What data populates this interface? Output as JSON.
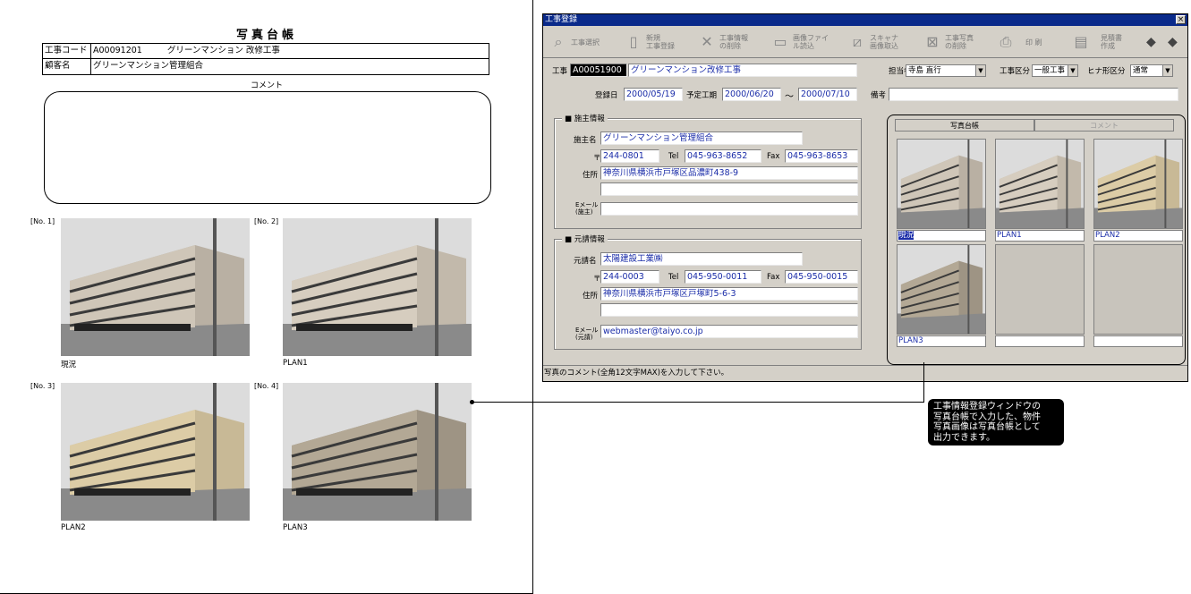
{
  "report": {
    "title": "写真台帳",
    "project_label": "工事コード",
    "project_code": "A00091201",
    "project_name": "グリーンマンション 改修工事",
    "customer_label": "顧客名",
    "customer_name": "グリーンマンション管理組合",
    "comment_label": "コメント",
    "photos": [
      {
        "num": "[No. 1]",
        "caption": "現況"
      },
      {
        "num": "[No. 2]",
        "caption": "PLAN1"
      },
      {
        "num": "[No. 3]",
        "caption": "PLAN2"
      },
      {
        "num": "[No. 4]",
        "caption": "PLAN3"
      }
    ]
  },
  "window": {
    "title": "工事登録",
    "close": "×",
    "toolbar": {
      "select": "工事選択",
      "new1": "新規",
      "new2": "工事登録",
      "del1": "工事情報",
      "del2": "の削除",
      "img1": "画像ファイ",
      "img2": "ル読込",
      "scan1": "スキャナ",
      "scan2": "画像取込",
      "pdel1": "工事写真",
      "pdel2": "の削除",
      "print": "印 刷",
      "est1": "見積書",
      "est2": "作成"
    },
    "form": {
      "project_label": "工事",
      "project_code": "A00051900",
      "project_name": "グリーンマンション改修工事",
      "staff_label": "担当者",
      "staff_value": "寺島 直行",
      "category_label": "工事区分",
      "category_value": "一般工事",
      "template_label": "ヒナ形区分",
      "template_value": "通常",
      "reg_date_label": "登録日",
      "reg_date": "2000/05/19",
      "period_label": "予定工期",
      "period_start": "2000/06/20",
      "period_sep": "～",
      "period_end": "2000/07/10",
      "note_label": "備考"
    },
    "owner": {
      "section": "■ 施主情報",
      "name_label": "施主名",
      "name": "グリーンマンション管理組合",
      "zip_label": "〒",
      "zip": "244-0801",
      "tel_label": "Tel",
      "tel": "045-963-8652",
      "fax_label": "Fax",
      "fax": "045-963-8653",
      "addr_label": "住所",
      "addr": "神奈川県横浜市戸塚区品濃町438-9",
      "email_label1": "Eメール",
      "email_label2": "(施主)"
    },
    "contractor": {
      "section": "■ 元請情報",
      "name_label": "元請名",
      "name": "太陽建設工業㈱",
      "zip_label": "〒",
      "zip": "244-0003",
      "tel_label": "Tel",
      "tel": "045-950-0011",
      "fax_label": "Fax",
      "fax": "045-950-0015",
      "addr_label": "住所",
      "addr": "神奈川県横浜市戸塚区戸塚町5-6-3",
      "email_label1": "Eメール",
      "email_label2": "(元請)",
      "email": "webmaster@taiyo.co.jp"
    },
    "photo_panel": {
      "tab_photos": "写真台帳",
      "tab_comment": "コメント",
      "captions": [
        "現況",
        "PLAN1",
        "PLAN2",
        "PLAN3",
        "",
        ""
      ]
    },
    "status": "写真のコメント(全角12文字MAX)を入力して下さい。"
  },
  "callout": {
    "line1": "工事情報登録ウィンドウの",
    "line2": "写真台帳で入力した、物件",
    "line3": "写真画像は写真台帳として",
    "line4": "出力できます。"
  }
}
